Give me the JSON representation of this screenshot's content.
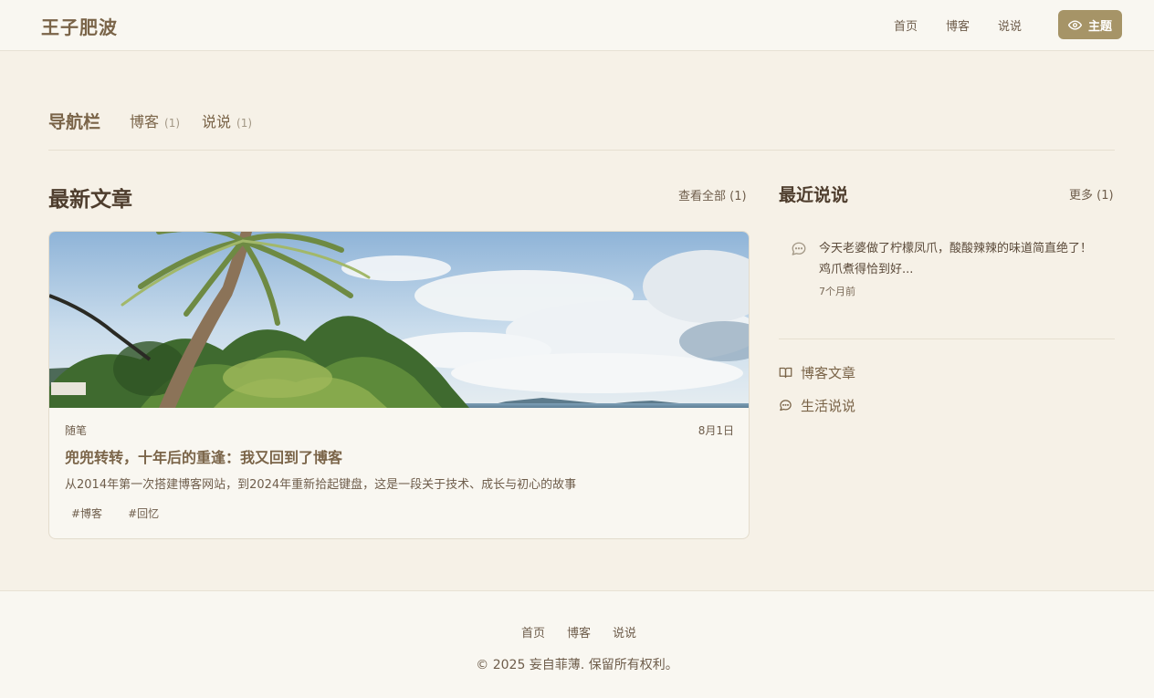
{
  "header": {
    "brand": "王子肥波",
    "nav": [
      "首页",
      "博客",
      "说说"
    ],
    "theme_label": "主题"
  },
  "navbar": {
    "title": "导航栏",
    "items": [
      {
        "label": "博客",
        "count": "(1)"
      },
      {
        "label": "说说",
        "count": "(1)"
      }
    ]
  },
  "latest": {
    "title": "最新文章",
    "view_all": "查看全部 (1)",
    "post": {
      "category": "随笔",
      "date": "8月1日",
      "title": "兜兜转转，十年后的重逢：我又回到了博客",
      "excerpt": "从2014年第一次搭建博客网站，到2024年重新拾起键盘，这是一段关于技术、成长与初心的故事",
      "tags": [
        "#博客",
        "#回忆"
      ]
    }
  },
  "recent": {
    "title": "最近说说",
    "more": "更多 (1)",
    "item": {
      "text": "今天老婆做了柠檬凤爪，酸酸辣辣的味道简直绝了！鸡爪煮得恰到好...",
      "time": "7个月前"
    },
    "links": [
      {
        "label": "博客文章",
        "icon": "book-icon"
      },
      {
        "label": "生活说说",
        "icon": "chat-icon"
      }
    ]
  },
  "footer": {
    "nav": [
      "首页",
      "博客",
      "说说"
    ],
    "copyright": "© 2025 妄自菲薄. 保留所有权利。"
  },
  "colors": {
    "accent": "#a69467",
    "background": "#f6f1e7",
    "surface": "#f9f7f1",
    "brand_text": "#7a6448"
  }
}
